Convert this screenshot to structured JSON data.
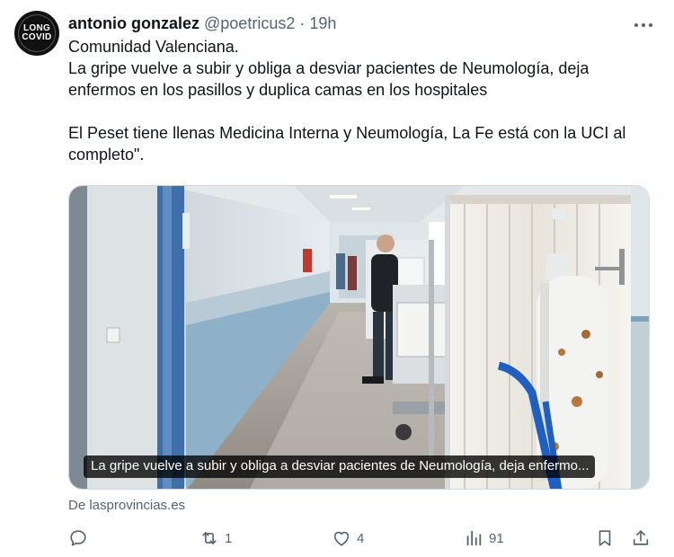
{
  "avatar": {
    "line1": "LONG",
    "line2": "COVID"
  },
  "author": {
    "name": "antonio gonzalez",
    "handle": "@poetricus2",
    "separator": "·",
    "time": "19h"
  },
  "tweet": {
    "line1": "Comunidad Valenciana.",
    "line2": "La gripe vuelve a subir y obliga a desviar pacientes de Neumología, deja enfermos en los pasillos y duplica camas en los hospitales",
    "line3": "El Peset tiene llenas Medicina Interna y Neumología, La Fe está con la UCI al completo\"."
  },
  "media": {
    "caption": "La gripe vuelve a subir y obliga a desviar pacientes de Neumología, deja enfermo..."
  },
  "source": "De lasprovincias.es",
  "actions": {
    "reply": {
      "icon": "reply-icon",
      "count": ""
    },
    "repost": {
      "icon": "repost-icon",
      "count": "1"
    },
    "like": {
      "icon": "heart-icon",
      "count": "4"
    },
    "views": {
      "icon": "views-icon",
      "count": "91"
    },
    "bookmark": {
      "icon": "bookmark-icon"
    },
    "share": {
      "icon": "share-icon"
    }
  },
  "colors": {
    "text": "#0f1419",
    "muted": "#536471",
    "border": "#cfd9de"
  }
}
